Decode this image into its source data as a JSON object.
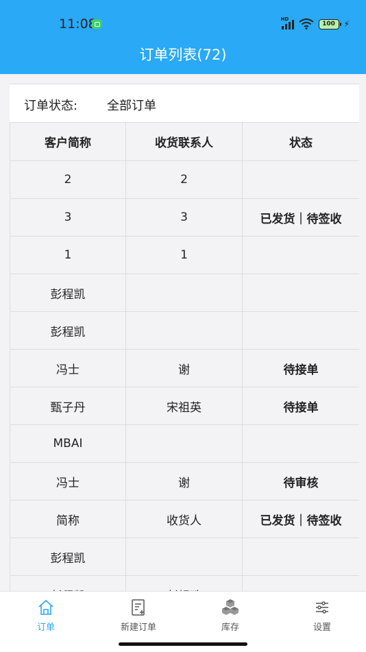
{
  "status_bar": {
    "time": "11:08",
    "battery": "100"
  },
  "header": {
    "title": "订单列表(72)"
  },
  "filter": {
    "label": "订单状态:",
    "value": "全部订单"
  },
  "table": {
    "columns": [
      "客户简称",
      "收货联系人",
      "状态"
    ],
    "rows": [
      [
        "2",
        "2",
        ""
      ],
      [
        "3",
        "3",
        "已发货｜待签收"
      ],
      [
        "1",
        "1",
        ""
      ],
      [
        "彭程凯",
        "",
        ""
      ],
      [
        "彭程凯",
        "",
        ""
      ],
      [
        "冯士",
        "谢",
        "待接单"
      ],
      [
        "甄子丹",
        "宋祖英",
        "待接单"
      ],
      [
        "MBAI",
        "",
        ""
      ],
      [
        "冯士",
        "谢",
        "待审核"
      ],
      [
        "简称",
        "收货人",
        "已发货｜待签收"
      ],
      [
        "彭程凯",
        "",
        ""
      ],
      [
        "彭程凯",
        "彭规珠",
        ""
      ]
    ]
  },
  "tabbar": {
    "items": [
      {
        "label": "订单",
        "icon": "home-icon",
        "active": true
      },
      {
        "label": "新建订单",
        "icon": "new-order-icon",
        "active": false
      },
      {
        "label": "库存",
        "icon": "inventory-icon",
        "active": false
      },
      {
        "label": "设置",
        "icon": "settings-icon",
        "active": false
      }
    ]
  },
  "colors": {
    "accent": "#29a9f6",
    "background": "#f3f3f5"
  }
}
